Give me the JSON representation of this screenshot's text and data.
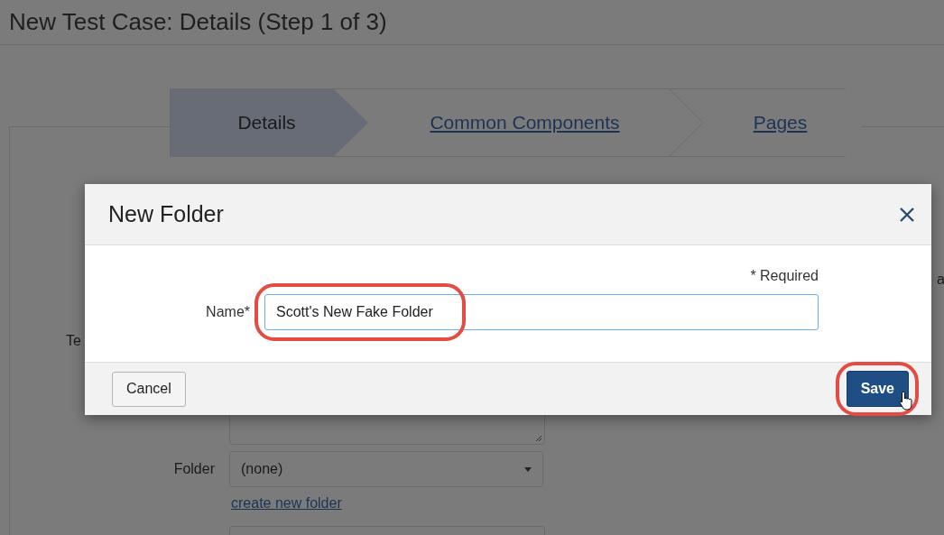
{
  "page": {
    "title": "New Test Case: Details (Step 1 of 3)",
    "steps": [
      {
        "label": "Details",
        "selected": true
      },
      {
        "label": "Common Components",
        "selected": false
      },
      {
        "label": "Pages",
        "selected": false
      }
    ],
    "cut_label": "Te",
    "cut_right_text": "a",
    "folder": {
      "label": "Folder",
      "value": "(none)"
    },
    "create_link": "create new folder"
  },
  "dialog": {
    "title": "New Folder",
    "required_note": "* Required",
    "name_label": "Name*",
    "name_value": "Scott's New Fake Folder",
    "buttons": [
      {
        "label": "Cancel",
        "kind": "secondary"
      },
      {
        "label": "Save",
        "kind": "primary"
      }
    ]
  }
}
